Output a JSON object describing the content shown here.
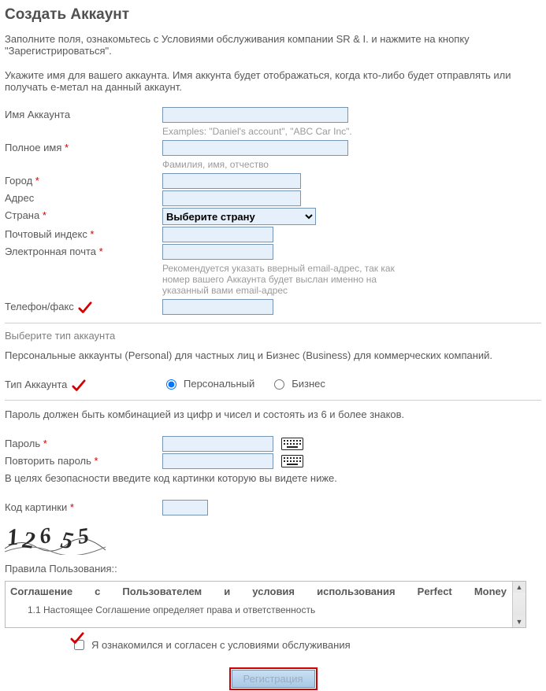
{
  "title": "Создать Аккаунт",
  "intro": "Заполните поля, ознакомьтесь с Условиями обслуживания компании SR & I. и нажмите на кнопку \"Зарегистрироваться\".",
  "note": "Укажите имя для вашего аккаунта. Имя аккунта будет отображаться, когда кто-либо будет отправлять или получать e-метал на данный аккаунт.",
  "fields": {
    "account_name": {
      "label": "Имя Аккаунта",
      "value": "",
      "hint": "Examples: \"Daniel's account\", \"ABC Car Inc\"."
    },
    "full_name": {
      "label": "Полное имя",
      "value": "",
      "hint": "Фамилия, имя, отчество"
    },
    "city": {
      "label": "Город",
      "value": ""
    },
    "address": {
      "label": "Адрес",
      "value": ""
    },
    "country": {
      "label": "Страна",
      "selected": "Выберите страну"
    },
    "postal": {
      "label": "Почтовый индекс",
      "value": ""
    },
    "email": {
      "label": "Электронная почта",
      "value": "",
      "hint": "Рекомендуется указать вверный email-адрес, так как номер вашего Аккаунта будет выслан именно на указанный вами email-адрес"
    },
    "phone": {
      "label": "Телефон/факс",
      "value": ""
    }
  },
  "account_type_section": {
    "header": "Выберите тип аккаунта",
    "desc": "Персональные аккаунты (Personal) для частных лиц и Бизнес (Business) для коммерческих компаний.",
    "label": "Тип Аккаунта",
    "personal": "Персональный",
    "business": "Бизнес"
  },
  "password_section": {
    "desc": "Пароль должен быть комбинацией из цифр и чисел и состоять из 6 и более знаков.",
    "password_label": "Пароль",
    "repeat_label": "Повторить пароль",
    "security_note": "В целях безопасности введите код картинки которую вы видете ниже.",
    "captcha_label": "Код картинки",
    "captcha_text": "12655"
  },
  "terms": {
    "label_header": "Правила Пользования::",
    "title": "Соглашение с Пользователем и условия использования Perfect Money",
    "body": "1.1 Настоящее Соглашение определяет права и ответственность"
  },
  "agree_label": "Я ознакомился и согласен с условиями обслуживания",
  "submit_label": "Регистрация"
}
